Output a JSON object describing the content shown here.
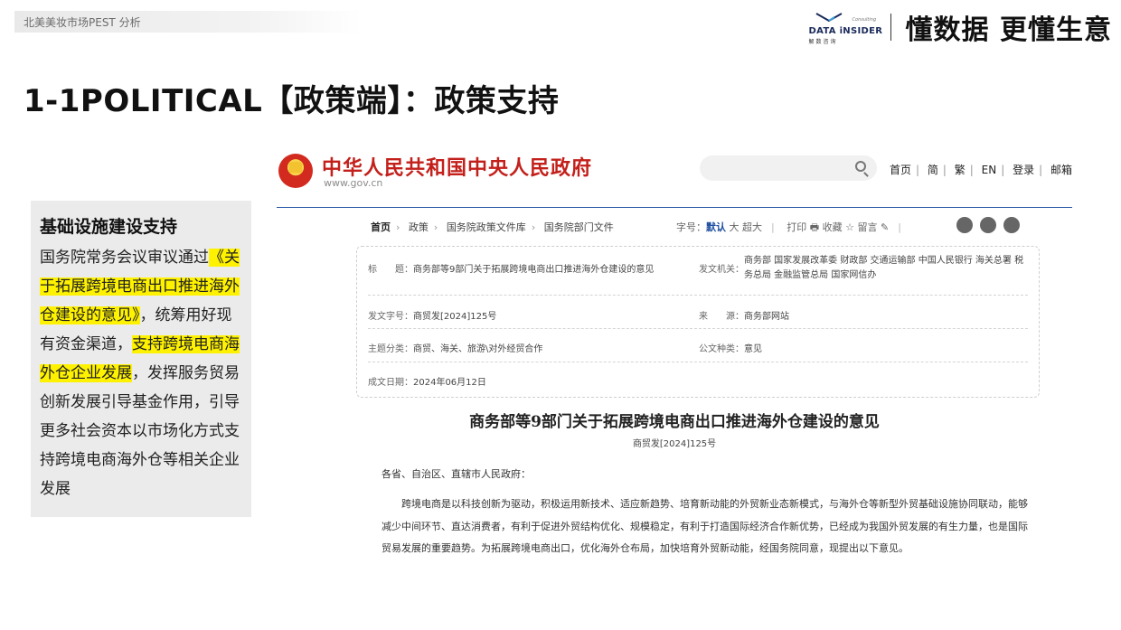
{
  "header": {
    "section": "北美美妆市场PEST 分析"
  },
  "brand": {
    "logo_text": "DATA iNSIDER",
    "logo_sub": "解数咨询",
    "logo_tag": "Consulting",
    "slogan": "懂数据 更懂生意"
  },
  "title": "1-1POLITICAL【政策端】：政策支持",
  "sidebar": {
    "heading": "基础设施建设支持",
    "p1": "国务院常务会议审议通过",
    "hl1": "《关于拓展跨境电商出口推进海外仓建设的意见》",
    "p2": "，统筹用好现有资金渠道，",
    "hl2": "支持跨境电商海外仓企业发展",
    "p3": "，发挥服务贸易创新发展引导基金作用，引导更多社会资本以市场化方式支持跨境电商海外仓等相关企业发展"
  },
  "gov": {
    "site_name": "中华人民共和国中央人民政府",
    "url": "www.gov.cn",
    "links": [
      "首页",
      "简",
      "繁",
      "EN",
      "登录",
      "邮箱"
    ],
    "breadcrumb": [
      "首页",
      "政策",
      "国务院政策文件库",
      "国务院部门文件"
    ],
    "font_label": "字号：",
    "font_default": "默认",
    "font_large": "大",
    "font_xl": "超大",
    "print": "打印",
    "collect": "收藏 ☆",
    "comment": "留言",
    "meta": {
      "title_label": "标　　题：",
      "title_value": "商务部等9部门关于拓展跨境电商出口推进海外仓建设的意见",
      "issuer_label": "发文机关：",
      "issuer_value": "商务部 国家发展改革委 财政部 交通运输部 中国人民银行 海关总署 税务总局 金融监管总局 国家网信办",
      "docno_label": "发文字号：",
      "docno_value": "商贸发[2024]125号",
      "source_label": "来　　源：",
      "source_value": "商务部网站",
      "topic_label": "主题分类：",
      "topic_value": "商贸、海关、旅游\\对外经贸合作",
      "kind_label": "公文种类：",
      "kind_value": "意见",
      "date_label": "成文日期：",
      "date_value": "2024年06月12日"
    },
    "doc_title": "商务部等9部门关于拓展跨境电商出口推进海外仓建设的意见",
    "doc_no": "商贸发[2024]125号",
    "greeting": "各省、自治区、直辖市人民政府：",
    "body": "跨境电商是以科技创新为驱动，积极运用新技术、适应新趋势、培育新动能的外贸新业态新模式，与海外仓等新型外贸基础设施协同联动，能够减少中间环节、直达消费者，有利于促进外贸结构优化、规模稳定，有利于打造国际经济合作新优势，已经成为我国外贸发展的有生力量，也是国际贸易发展的重要趋势。为拓展跨境电商出口，优化海外仓布局，加快培育外贸新动能，经国务院同意，现提出以下意见。"
  }
}
